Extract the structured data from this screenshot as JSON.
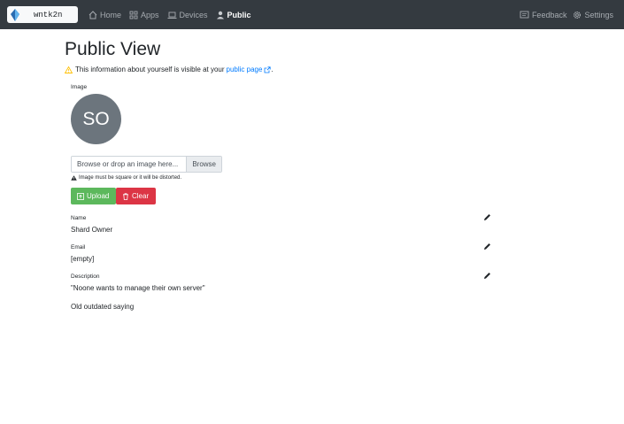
{
  "navbar": {
    "shard_name": "wntk2n",
    "items": [
      {
        "label": "Home",
        "icon": "house-icon"
      },
      {
        "label": "Apps",
        "icon": "grid-icon"
      },
      {
        "label": "Devices",
        "icon": "laptop-icon"
      },
      {
        "label": "Public",
        "icon": "person-icon"
      }
    ],
    "active": "Public",
    "right_items": [
      {
        "label": "Feedback",
        "icon": "feedback-icon"
      },
      {
        "label": "Settings",
        "icon": "gear-icon"
      }
    ]
  },
  "page": {
    "title": "Public View",
    "notice_text": "This information about yourself is visible at your",
    "notice_link": "public page",
    "notice_end": "."
  },
  "image_section": {
    "label": "Image",
    "avatar_initials": "SO",
    "file_placeholder": "Browse or drop an image here...",
    "browse_label": "Browse",
    "hint": "Image must be square or it will be distorted.",
    "upload_label": "Upload",
    "clear_label": "Clear"
  },
  "fields": {
    "name": {
      "label": "Name",
      "value": "Shard Owner"
    },
    "email": {
      "label": "Email",
      "value": "[empty]"
    },
    "description": {
      "label": "Description",
      "value": "\"Noone wants to manage their own server\""
    }
  },
  "saying": "Old outdated saying",
  "colors": {
    "navbar": "#343a40",
    "link": "#007bff",
    "upload": "#5cb85c",
    "clear": "#dc3545",
    "avatar": "#6c757d",
    "warning": "#ffc107"
  }
}
